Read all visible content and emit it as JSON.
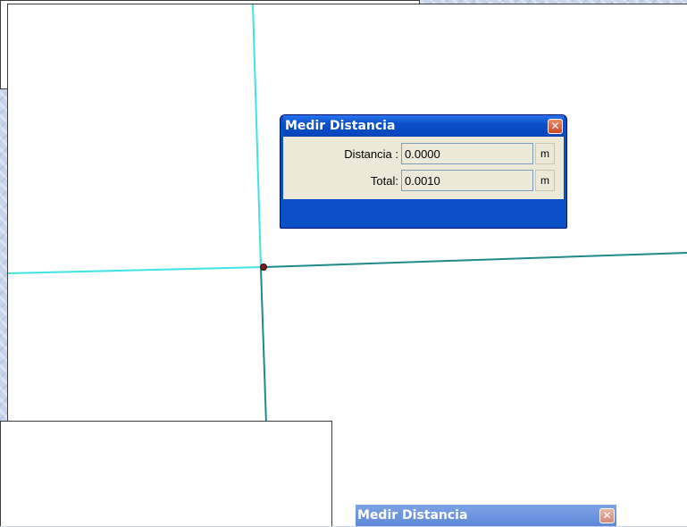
{
  "dialog": {
    "title": "Medir Distancia",
    "close_glyph": "✕",
    "distance_label": "Distancia :",
    "distance_value": "0.0000",
    "distance_unit": "m",
    "total_label": "Total:",
    "total_value": "0.0010",
    "total_unit": "m"
  },
  "ghost_dialog": {
    "title": "Medir Distancia",
    "close_glyph": "✕"
  },
  "colors": {
    "cyan_line": "#3fe3e6",
    "teal_line": "#1f8a8a",
    "point_marker": "#7a1f1f",
    "title_bar": "#0a4fc8"
  },
  "icons": {
    "close": "close-icon",
    "measurement_point": "point-marker-icon"
  }
}
